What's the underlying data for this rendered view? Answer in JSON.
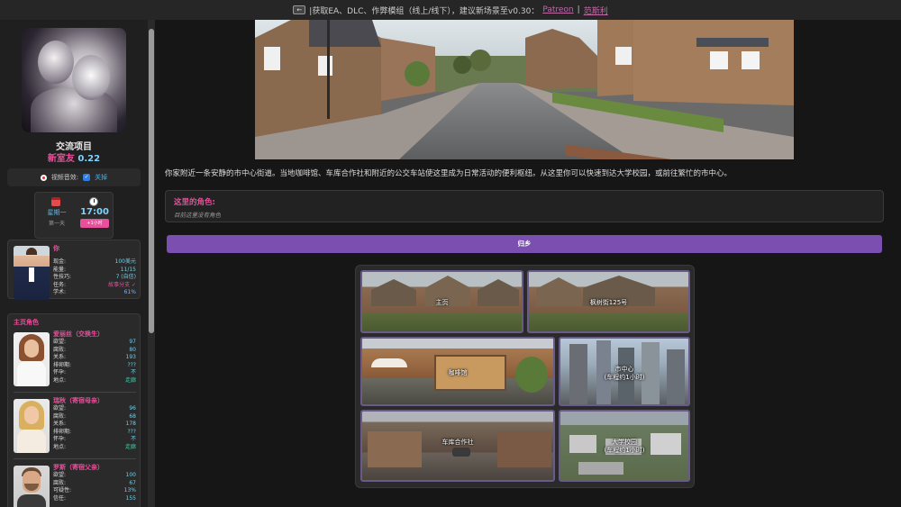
{
  "topbar": {
    "back_label": "←",
    "text": "|获取EA、DLC、作弊模组（线上/线下），建议新场景至v0.30：",
    "link1": "Patreon",
    "sep": "|",
    "link2": "范斯利"
  },
  "game": {
    "title": "交流项目",
    "name": "新室友",
    "version": "0.22"
  },
  "settings": {
    "sound_label": "视频音效:",
    "toggle_label": "关掉"
  },
  "time": {
    "weekday": "星期一",
    "day": "第一天",
    "clock": "17:00",
    "add_button": "+1小时"
  },
  "player": {
    "name": "你",
    "stats": [
      {
        "k": "现金:",
        "v": "100美元"
      },
      {
        "k": "能量:",
        "v": "11/15"
      },
      {
        "k": "性技巧:",
        "v": "7 (自信)"
      },
      {
        "k": "任务:",
        "v": "故事分支 ✓"
      },
      {
        "k": "学术:",
        "v": "61%"
      }
    ]
  },
  "roommates": {
    "title": "主页角色",
    "chars": [
      {
        "name": "爱丽丝（交换生）",
        "stats": [
          {
            "k": "欲望:",
            "v": "97"
          },
          {
            "k": "腐败:",
            "v": "80"
          },
          {
            "k": "关系:",
            "v": "193"
          },
          {
            "k": "排卵期:",
            "v": "???"
          },
          {
            "k": "怀孕:",
            "v": "不"
          },
          {
            "k": "地点:",
            "v": "走廊"
          }
        ]
      },
      {
        "name": "瑞秋（寄宿母亲）",
        "stats": [
          {
            "k": "欲望:",
            "v": "96"
          },
          {
            "k": "腐败:",
            "v": "68"
          },
          {
            "k": "关系:",
            "v": "178"
          },
          {
            "k": "排卵期:",
            "v": "???"
          },
          {
            "k": "怀孕:",
            "v": "不"
          },
          {
            "k": "地点:",
            "v": "走廊"
          }
        ]
      },
      {
        "name": "罗斯（寄宿父亲）",
        "stats": [
          {
            "k": "欲望:",
            "v": "100"
          },
          {
            "k": "腐败:",
            "v": "67"
          },
          {
            "k": "可疑性:",
            "v": "13%"
          },
          {
            "k": "信任:",
            "v": "155"
          }
        ]
      }
    ]
  },
  "main": {
    "description": "你家附近一条安静的市中心街道。当地咖啡馆、车库合作社和附近的公交车站使这里成为日常活动的便利枢纽。从这里你可以快速到达大学校园，或前往繁忙的市中心。",
    "chars_title": "这里的角色:",
    "chars_empty": "目前这里没有角色",
    "home_button": "归乡"
  },
  "locations": [
    {
      "label": "主页"
    },
    {
      "label": "枫树街125号"
    },
    {
      "label": "咖啡馆"
    },
    {
      "label": "市中心",
      "sub": "(车程约1小时)"
    },
    {
      "label": "车库合作社"
    },
    {
      "label": "大学校园",
      "sub": "(车程约1小时)"
    }
  ],
  "colors": {
    "accent_pink": "#e94f9a",
    "accent_purple": "#7a4fb0",
    "accent_cyan": "#7fd3ff"
  }
}
